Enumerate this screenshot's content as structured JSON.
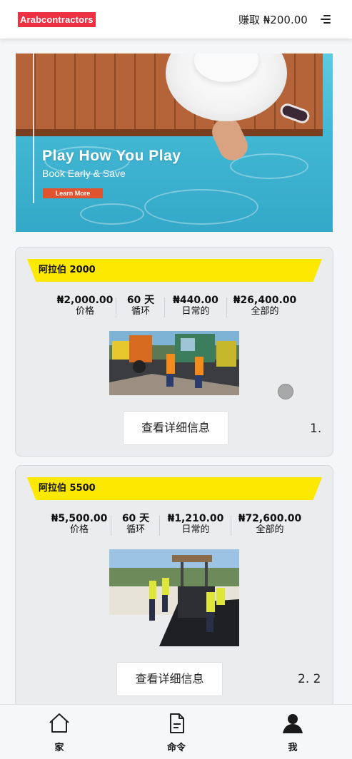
{
  "header": {
    "logo": "Arabcontractors",
    "earn": "赚取 ₦200.00"
  },
  "banner": {
    "title": "Play How You Play",
    "subtitle": "Book Early & Save",
    "button": "Learn More"
  },
  "products": [
    {
      "name": "阿拉伯 2000",
      "price": "₦2,000.00",
      "price_label": "价格",
      "cycle": "60 天",
      "cycle_label": "循环",
      "daily": "₦440.00",
      "daily_label": "日常的",
      "total": "₦26,400.00",
      "total_label": "全部的",
      "details_button": "查看详细信息",
      "index": "1."
    },
    {
      "name": "阿拉伯 5500",
      "price": "₦5,500.00",
      "price_label": "价格",
      "cycle": "60 天",
      "cycle_label": "循环",
      "daily": "₦1,210.00",
      "daily_label": "日常的",
      "total": "₦72,600.00",
      "total_label": "全部的",
      "details_button": "查看详细信息",
      "index": "2. 2"
    }
  ],
  "nav": [
    {
      "label": "家",
      "icon": "home-icon"
    },
    {
      "label": "命令",
      "icon": "document-icon"
    },
    {
      "label": "我",
      "icon": "user-icon"
    }
  ],
  "colors": {
    "logo_bg": "#ee3142",
    "ribbon": "#fce800",
    "banner_button": "#e0532e",
    "card_bg": "#ebecee"
  }
}
